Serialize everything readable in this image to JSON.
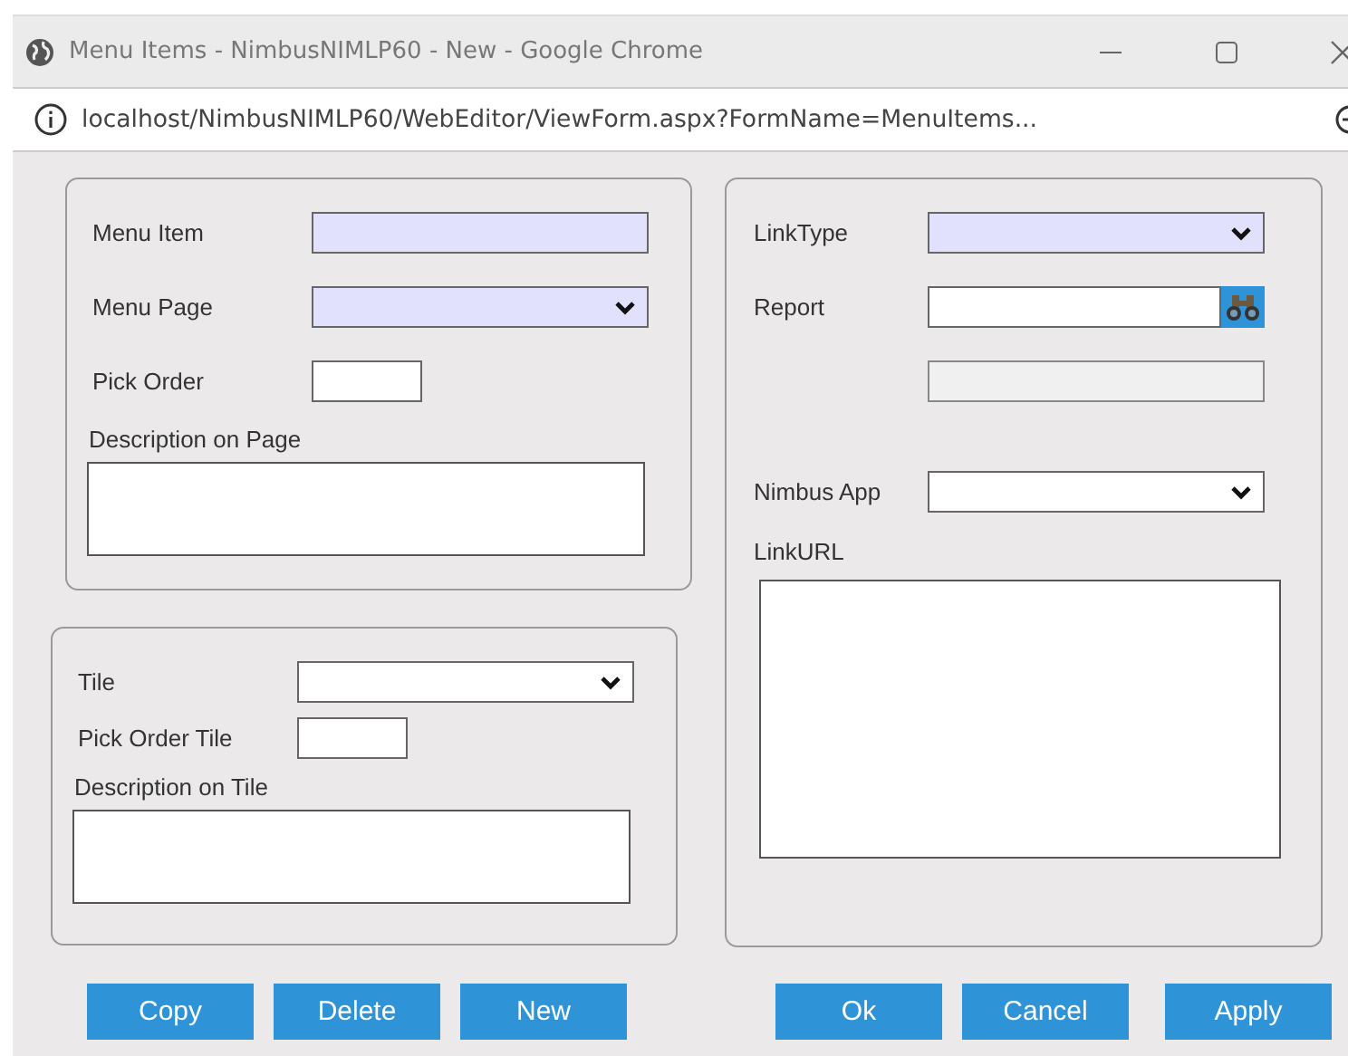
{
  "window": {
    "title": "Menu Items - NimbusNIMLP60 - New - Google Chrome",
    "url": "localhost/NimbusNIMLP60/WebEditor/ViewForm.aspx?FormName=MenuItems..."
  },
  "panels": [
    {
      "fields": [
        {
          "kind": "text",
          "label": "Menu Item",
          "required": true
        },
        {
          "kind": "select",
          "label": "Menu Page",
          "required": true
        },
        {
          "kind": "short",
          "label": "Pick Order",
          "required": false
        },
        {
          "kind": "area",
          "label": "Description on Page",
          "required": false
        }
      ]
    },
    {
      "fields": [
        {
          "kind": "select",
          "label": "Tile",
          "required": false
        },
        {
          "kind": "short",
          "label": "Pick Order Tile",
          "required": false
        },
        {
          "kind": "area",
          "label": "Description on Tile",
          "required": false
        }
      ]
    },
    {
      "fields": [
        {
          "kind": "select",
          "label": "LinkType",
          "required": true
        },
        {
          "kind": "lookup",
          "label": "Report",
          "required": false
        },
        {
          "kind": "readonly",
          "required": false
        },
        {
          "kind": "select",
          "label": "Nimbus App",
          "required": false
        },
        {
          "kind": "bigarea",
          "label": "LinkURL",
          "required": false
        }
      ]
    }
  ],
  "buttons_left": [
    "Copy",
    "Delete",
    "New"
  ],
  "buttons_right": [
    "Ok",
    "Cancel",
    "Apply"
  ]
}
